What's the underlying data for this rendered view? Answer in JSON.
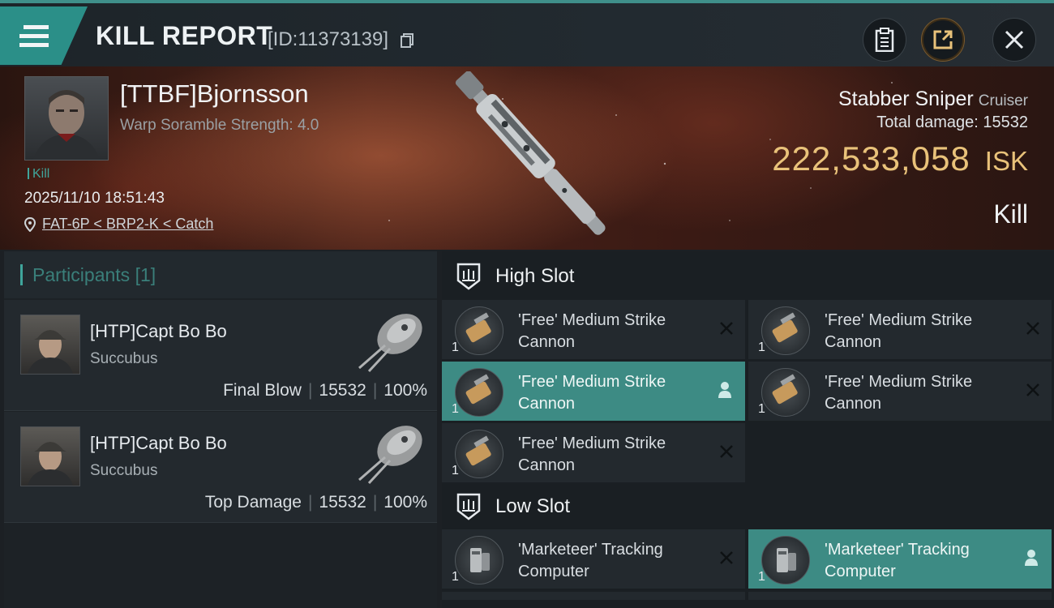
{
  "header": {
    "title": "KILL REPORT",
    "report_id": "[ID:11373139]",
    "menu_icon": "hamburger-icon",
    "buttons": [
      "clipboard-icon",
      "export-icon",
      "close-icon"
    ]
  },
  "victim": {
    "name": "[TTBF]Bjornsson",
    "scramble": "Warp Soramble Strength: 4.0",
    "tag": "Kill",
    "datetime": "2025/11/10 18:51:43",
    "location": "FAT-6P < BRP2-K < Catch",
    "ship": "Stabber Sniper",
    "ship_class": "Cruiser",
    "total_damage": "Total damage: 15532",
    "value": "222,533,058",
    "currency": "ISK",
    "result": "Kill"
  },
  "participants": {
    "title": "Participants",
    "count": "[1]",
    "items": [
      {
        "name": "[HTP]Capt Bo Bo",
        "ship": "Succubus",
        "role": "Final Blow",
        "damage": "15532",
        "percent": "100%"
      },
      {
        "name": "[HTP]Capt Bo Bo",
        "ship": "Succubus",
        "role": "Top Damage",
        "damage": "15532",
        "percent": "100%"
      }
    ]
  },
  "slots": {
    "high": {
      "title": "High Slot",
      "modules": [
        {
          "name": "'Free' Medium Strike Cannon",
          "qty": "1",
          "fitted": false
        },
        {
          "name": "'Free' Medium Strike Cannon",
          "qty": "1",
          "fitted": false
        },
        {
          "name": "'Free' Medium Strike Cannon",
          "qty": "1",
          "fitted": true
        },
        {
          "name": "'Free' Medium Strike Cannon",
          "qty": "1",
          "fitted": false
        },
        {
          "name": "'Free' Medium Strike Cannon",
          "qty": "1",
          "fitted": false
        }
      ]
    },
    "low": {
      "title": "Low Slot",
      "modules": [
        {
          "name": "'Marketeer' Tracking Computer",
          "qty": "1",
          "fitted": false
        },
        {
          "name": "'Marketeer' Tracking Computer",
          "qty": "1",
          "fitted": true
        }
      ]
    }
  },
  "colors": {
    "accent": "#3d8b84",
    "isk": "#e9c27a",
    "background": "#1c2024"
  }
}
